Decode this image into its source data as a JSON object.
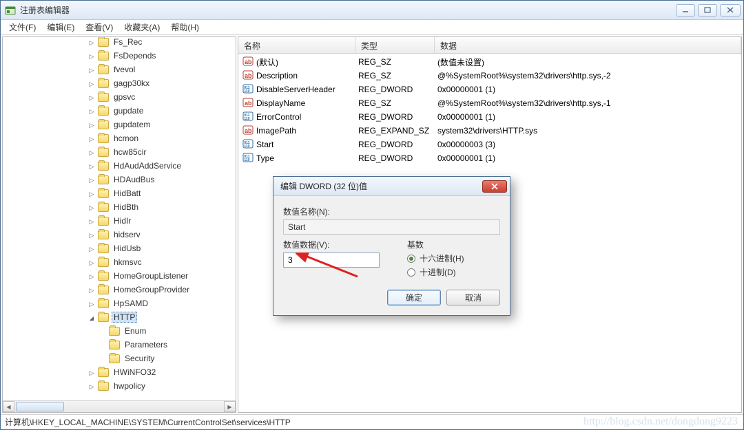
{
  "window": {
    "title": "注册表编辑器"
  },
  "menu": {
    "file": "文件(F)",
    "edit": "编辑(E)",
    "view": "查看(V)",
    "favorites": "收藏夹(A)",
    "help": "帮助(H)"
  },
  "tree": {
    "items": [
      {
        "indent": 2,
        "expand": "col",
        "label": "Fs_Rec"
      },
      {
        "indent": 2,
        "expand": "col",
        "label": "FsDepends"
      },
      {
        "indent": 2,
        "expand": "col",
        "label": "fvevol"
      },
      {
        "indent": 2,
        "expand": "col",
        "label": "gagp30kx"
      },
      {
        "indent": 2,
        "expand": "col",
        "label": "gpsvc"
      },
      {
        "indent": 2,
        "expand": "col",
        "label": "gupdate"
      },
      {
        "indent": 2,
        "expand": "col",
        "label": "gupdatem"
      },
      {
        "indent": 2,
        "expand": "col",
        "label": "hcmon"
      },
      {
        "indent": 2,
        "expand": "col",
        "label": "hcw85cir"
      },
      {
        "indent": 2,
        "expand": "col",
        "label": "HdAudAddService"
      },
      {
        "indent": 2,
        "expand": "col",
        "label": "HDAudBus"
      },
      {
        "indent": 2,
        "expand": "col",
        "label": "HidBatt"
      },
      {
        "indent": 2,
        "expand": "col",
        "label": "HidBth"
      },
      {
        "indent": 2,
        "expand": "col",
        "label": "HidIr"
      },
      {
        "indent": 2,
        "expand": "col",
        "label": "hidserv"
      },
      {
        "indent": 2,
        "expand": "col",
        "label": "HidUsb"
      },
      {
        "indent": 2,
        "expand": "col",
        "label": "hkmsvc"
      },
      {
        "indent": 2,
        "expand": "col",
        "label": "HomeGroupListener"
      },
      {
        "indent": 2,
        "expand": "col",
        "label": "HomeGroupProvider"
      },
      {
        "indent": 2,
        "expand": "col",
        "label": "HpSAMD"
      },
      {
        "indent": 2,
        "expand": "exp",
        "label": "HTTP",
        "selected": true
      },
      {
        "indent": 3,
        "expand": "leaf",
        "label": "Enum"
      },
      {
        "indent": 3,
        "expand": "leaf",
        "label": "Parameters"
      },
      {
        "indent": 3,
        "expand": "leaf",
        "label": "Security"
      },
      {
        "indent": 2,
        "expand": "col",
        "label": "HWiNFO32"
      },
      {
        "indent": 2,
        "expand": "col",
        "label": "hwpolicy"
      }
    ]
  },
  "list": {
    "cols": {
      "name": "名称",
      "type": "类型",
      "data": "数据"
    },
    "rows": [
      {
        "icon": "sz",
        "name": "(默认)",
        "type": "REG_SZ",
        "data": "(数值未设置)"
      },
      {
        "icon": "sz",
        "name": "Description",
        "type": "REG_SZ",
        "data": "@%SystemRoot%\\system32\\drivers\\http.sys,-2"
      },
      {
        "icon": "dw",
        "name": "DisableServerHeader",
        "type": "REG_DWORD",
        "data": "0x00000001 (1)"
      },
      {
        "icon": "sz",
        "name": "DisplayName",
        "type": "REG_SZ",
        "data": "@%SystemRoot%\\system32\\drivers\\http.sys,-1"
      },
      {
        "icon": "dw",
        "name": "ErrorControl",
        "type": "REG_DWORD",
        "data": "0x00000001 (1)"
      },
      {
        "icon": "sz",
        "name": "ImagePath",
        "type": "REG_EXPAND_SZ",
        "data": "system32\\drivers\\HTTP.sys"
      },
      {
        "icon": "dw",
        "name": "Start",
        "type": "REG_DWORD",
        "data": "0x00000003 (3)"
      },
      {
        "icon": "dw",
        "name": "Type",
        "type": "REG_DWORD",
        "data": "0x00000001 (1)"
      }
    ]
  },
  "dialog": {
    "title": "编辑 DWORD (32 位)值",
    "name_label": "数值名称(N):",
    "name_value": "Start",
    "value_label": "数值数据(V):",
    "value": "3",
    "base_label": "基数",
    "radio_hex": "十六进制(H)",
    "radio_dec": "十进制(D)",
    "ok": "确定",
    "cancel": "取消"
  },
  "status": {
    "path": "计算机\\HKEY_LOCAL_MACHINE\\SYSTEM\\CurrentControlSet\\services\\HTTP"
  },
  "watermark": "http://blog.csdn.net/dongdong9223"
}
